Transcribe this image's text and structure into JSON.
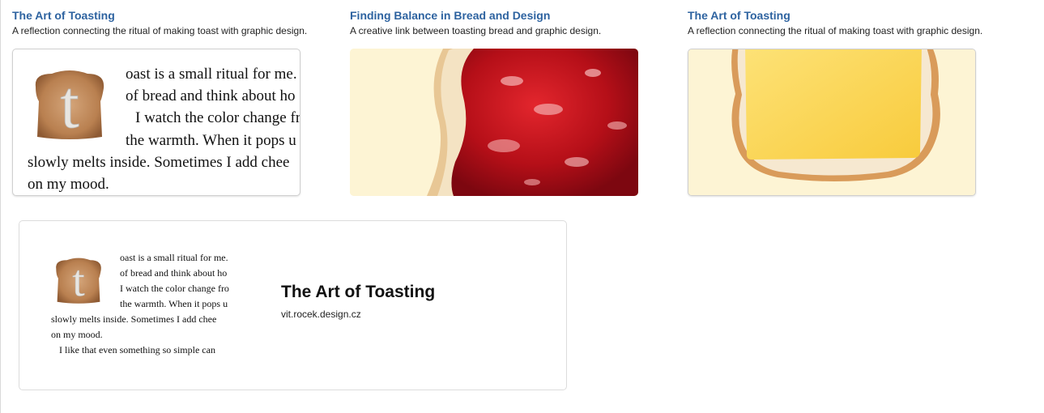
{
  "cards": [
    {
      "title": "The Art of Toasting",
      "description": "A reflection connecting the ritual of making toast with graphic design.",
      "image": "toast-text-preview"
    },
    {
      "title": "Finding Balance in Bread and Design",
      "description": "A creative link between toasting bread and graphic design.",
      "image": "bread-with-jam"
    },
    {
      "title": "The Art of Toasting",
      "description": "A reflection connecting the ritual of making toast with graphic design.",
      "image": "bread-with-cheese"
    }
  ],
  "toast_text": {
    "drop_cap": "t",
    "lines": [
      "oast is a small ritual for me.",
      "of bread and think about ho",
      "I watch the color change fro",
      "the warmth. When it pops u",
      "slowly melts inside. Sometimes I add chee",
      "on my mood.",
      "I like that even something so simple can"
    ]
  },
  "link_preview": {
    "title": "The Art of Toasting",
    "url": "vit.rocek.design.cz"
  },
  "colors": {
    "link_title": "#2e63a0",
    "cream_background": "#fdf4d4",
    "jam": "#c0111c",
    "cheese": "#fbd24a"
  }
}
